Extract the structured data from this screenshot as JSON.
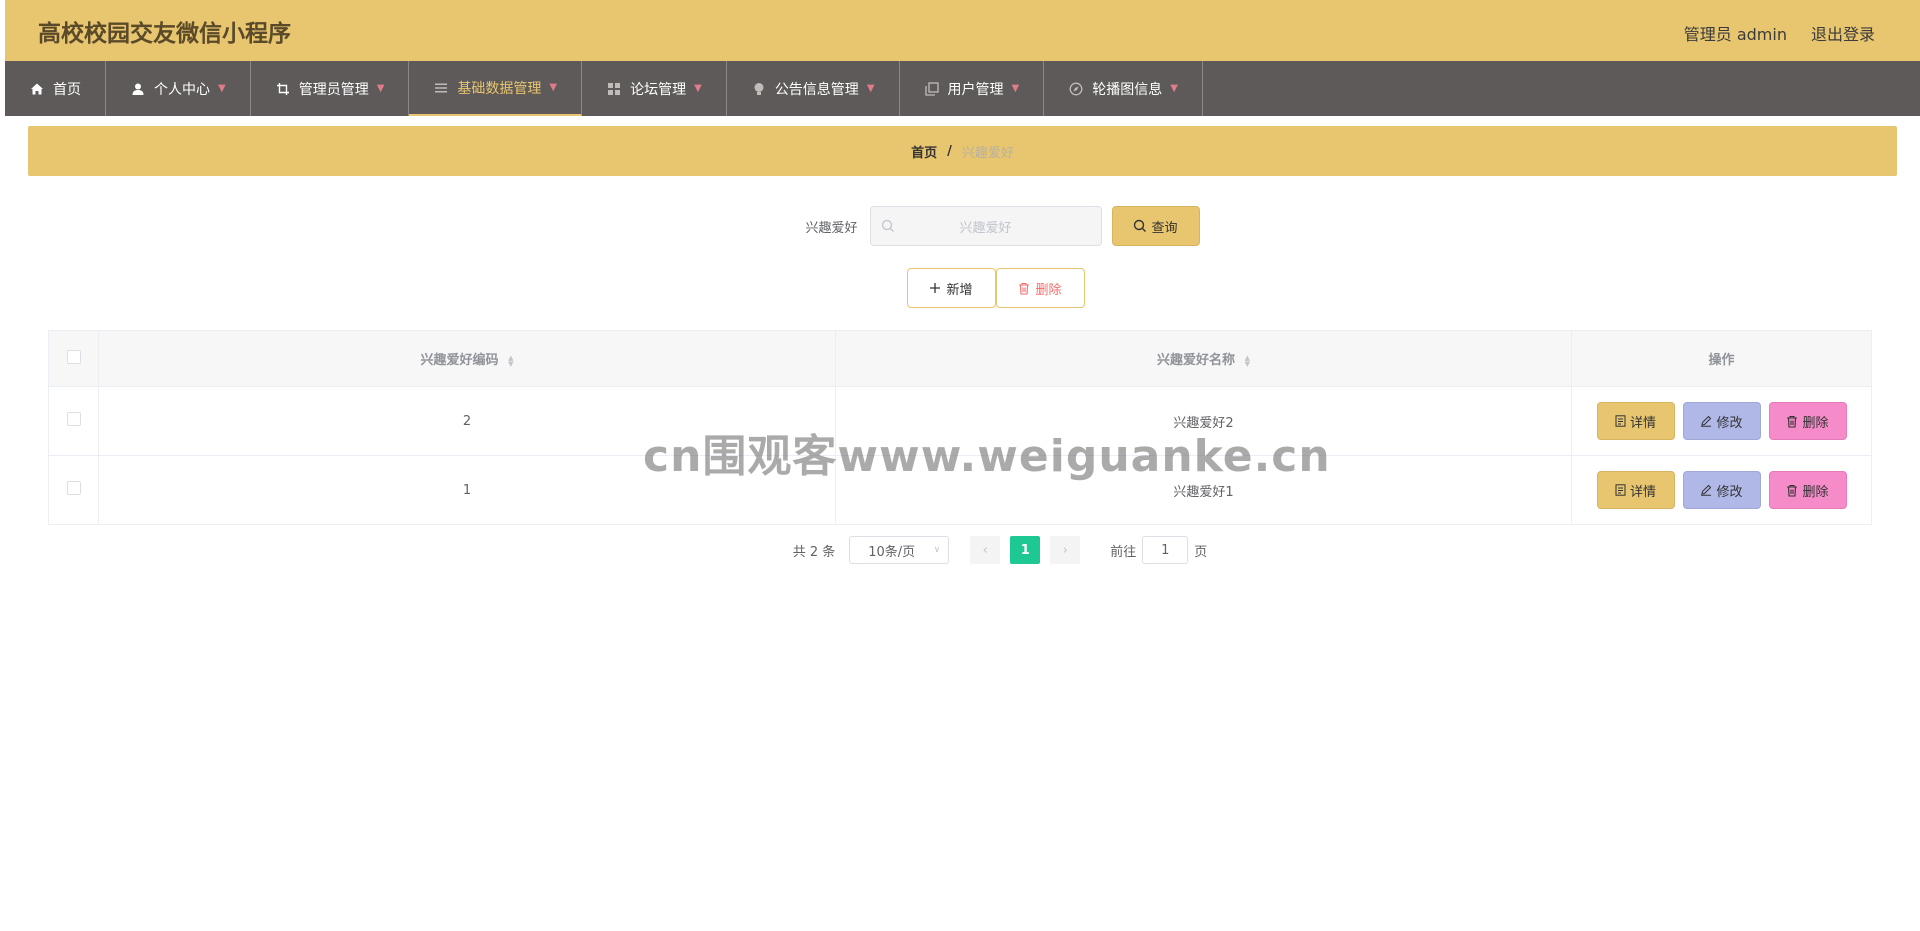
{
  "header": {
    "title": "高校校园交友微信小程序",
    "admin_label": "管理员 admin",
    "logout_label": "退出登录"
  },
  "nav": {
    "items": [
      {
        "label": "首页",
        "icon": "home-icon"
      },
      {
        "label": "个人中心",
        "icon": "user-icon"
      },
      {
        "label": "管理员管理",
        "icon": "crop-icon"
      },
      {
        "label": "基础数据管理",
        "icon": "menu-icon"
      },
      {
        "label": "论坛管理",
        "icon": "grid-icon"
      },
      {
        "label": "公告信息管理",
        "icon": "bulb-icon"
      },
      {
        "label": "用户管理",
        "icon": "copy-icon"
      },
      {
        "label": "轮播图信息",
        "icon": "compass-icon"
      }
    ],
    "active_index": 3
  },
  "breadcrumb": {
    "home": "首页",
    "separator": "/",
    "current": "兴趣爱好"
  },
  "search": {
    "label": "兴趣爱好",
    "placeholder": "兴趣爱好",
    "query_button": "查询"
  },
  "actions": {
    "add_button": "新增",
    "delete_button": "删除"
  },
  "table": {
    "columns": [
      "兴趣爱好编码",
      "兴趣爱好名称",
      "操作"
    ],
    "rows": [
      {
        "code": "2",
        "name": "兴趣爱好2"
      },
      {
        "code": "1",
        "name": "兴趣爱好1"
      }
    ],
    "row_actions": {
      "detail": "详情",
      "edit": "修改",
      "delete": "删除"
    }
  },
  "pagination": {
    "total_text": "共 2 条",
    "page_size": "10条/页",
    "current_page": "1",
    "goto_prefix": "前往",
    "goto_value": "1",
    "goto_suffix": "页"
  },
  "watermark": "cn围观客www.weiguanke.cn",
  "colors": {
    "header_bg": "#e8c56f",
    "nav_bg": "#5d5a59",
    "active_page": "#1ec893",
    "edit_btn": "#b0b8e8",
    "delete_btn": "#f58bc8"
  }
}
